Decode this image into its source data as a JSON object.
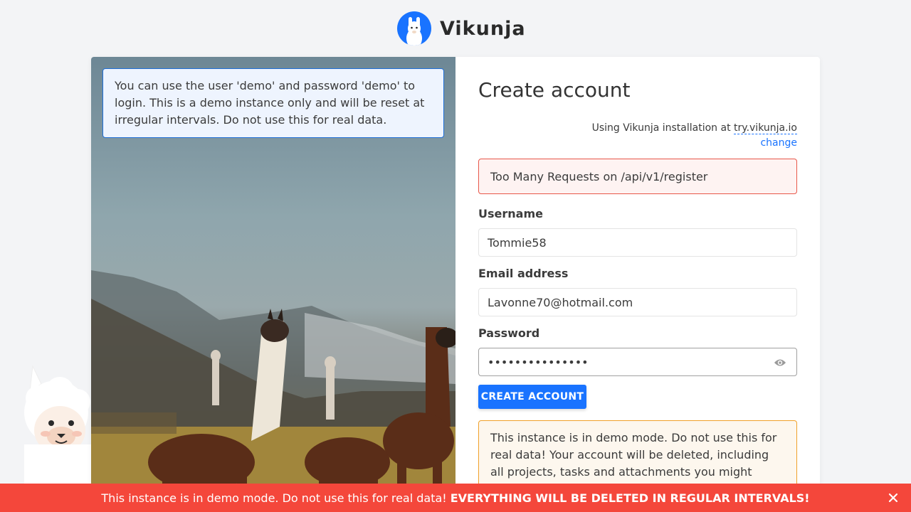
{
  "brand": {
    "name": "Vikunja",
    "accent": "#1973ff"
  },
  "info": {
    "text": "You can use the user 'demo' and password 'demo' to login. This is a demo instance only and will be reset at irregular intervals. Do not use this for real data."
  },
  "form": {
    "title": "Create account",
    "install_prefix": "Using Vikunja installation at",
    "install_domain": "try.vikunja.io",
    "change_label": "change",
    "error": "Too Many Requests on /api/v1/register",
    "username_label": "Username",
    "username_value": "Tommie58",
    "email_label": "Email address",
    "email_value": "Lavonne70@hotmail.com",
    "password_label": "Password",
    "password_value": "•••••••••••••••",
    "submit_label": "CREATE ACCOUNT",
    "demo_warning": "This instance is in demo mode. Do not use this for real data! Your account will be deleted, including all projects, tasks and attachments you might create."
  },
  "banner": {
    "text": "This instance is in demo mode. Do not use this for real data!",
    "emphasis": "EVERYTHING WILL BE DELETED IN REGULAR INTERVALS!",
    "color": "#f4473b"
  },
  "icons": [
    "llama-logo-icon",
    "eye-icon",
    "close-icon",
    "llama-mascot-icon"
  ]
}
